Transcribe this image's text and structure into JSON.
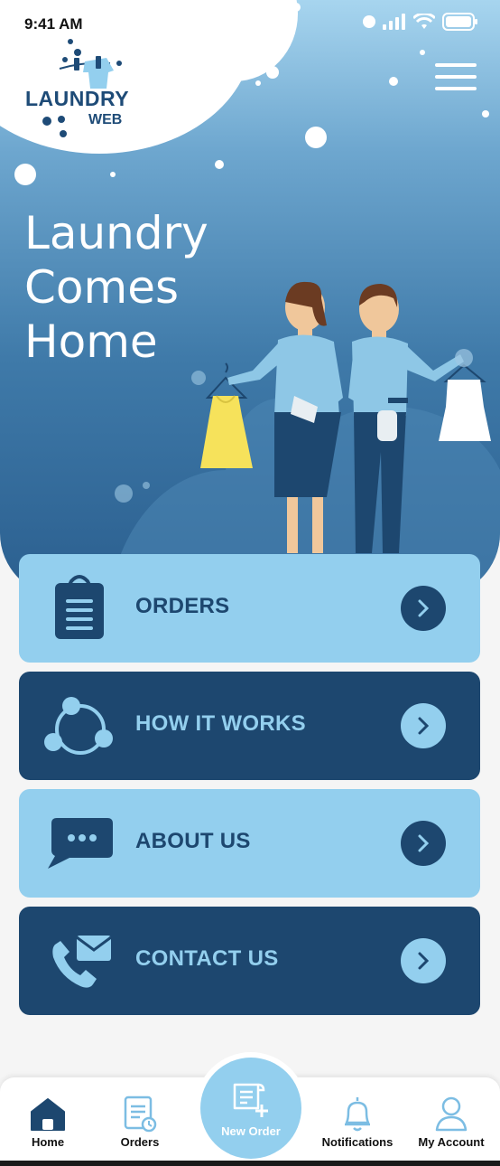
{
  "status_bar": {
    "time": "9:41 AM",
    "icons": [
      "signal-icon",
      "wifi-icon",
      "battery-icon"
    ]
  },
  "logo": {
    "line1": "LAUNDRY",
    "line2": "WEB"
  },
  "hero": {
    "headline_line1": "Laundry",
    "headline_line2": "Comes",
    "headline_line3": "Home"
  },
  "menu": [
    {
      "label": "ORDERS",
      "icon": "clipboard-icon",
      "style": "light"
    },
    {
      "label": "HOW IT WORKS",
      "icon": "process-cycle-icon",
      "style": "dark"
    },
    {
      "label": "ABOUT US",
      "icon": "chat-bubble-icon",
      "style": "light"
    },
    {
      "label": "CONTACT US",
      "icon": "phone-mail-icon",
      "style": "dark"
    }
  ],
  "tab_bar": {
    "home": "Home",
    "orders": "Orders",
    "new_order": "New Order",
    "notifications": "Notifications",
    "account": "My Account"
  },
  "colors": {
    "primary": "#1d476f",
    "accent": "#93cfee",
    "background": "#f5f5f5"
  }
}
